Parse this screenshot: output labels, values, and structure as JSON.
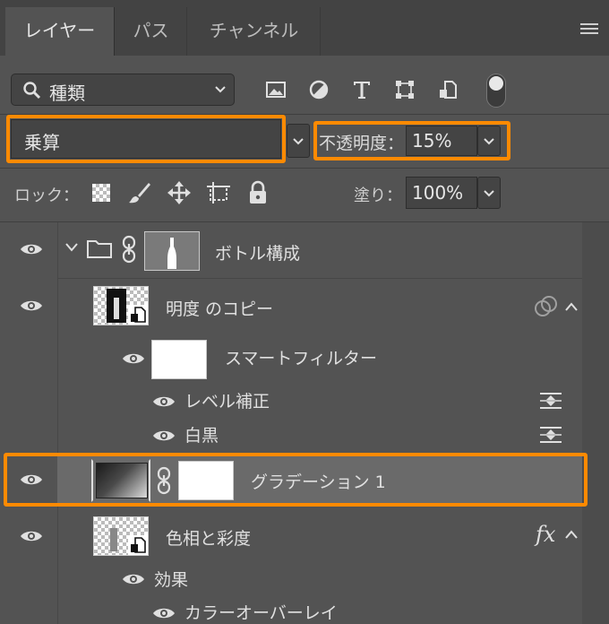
{
  "tabs": [
    {
      "label": "レイヤー",
      "active": true
    },
    {
      "label": "パス",
      "active": false
    },
    {
      "label": "チャンネル",
      "active": false
    }
  ],
  "filter": {
    "kind_label": "種類",
    "icons": [
      "search-icon",
      "image-filter-icon",
      "adjustment-filter-icon",
      "type-filter-icon",
      "shape-filter-icon",
      "smart-object-filter-icon"
    ]
  },
  "blend": {
    "mode": "乗算",
    "opacity_label": "不透明度：",
    "opacity_value": "15%"
  },
  "lock": {
    "label": "ロック：",
    "icons": [
      "lock-transparency-icon",
      "lock-paint-icon",
      "lock-position-icon",
      "lock-artboard-icon",
      "lock-all-icon"
    ],
    "fill_label": "塗り：",
    "fill_value": "100%"
  },
  "layers": {
    "group": {
      "name": "ボトル構成"
    },
    "copy": {
      "name": "明度 のコピー"
    },
    "smart_filter": {
      "name": "スマートフィルター"
    },
    "filter_levels": {
      "name": "レベル補正"
    },
    "filter_bw": {
      "name": "白黒"
    },
    "gradient": {
      "name": "グラデーション 1"
    },
    "hue": {
      "name": "色相と彩度",
      "fx": "fx"
    },
    "effects": {
      "name": "効果"
    },
    "color_overlay": {
      "name": "カラーオーバーレイ"
    }
  },
  "colors": {
    "highlight": "#ff8a00",
    "selected_row": "#6a6a6a",
    "panel": "#535353"
  }
}
